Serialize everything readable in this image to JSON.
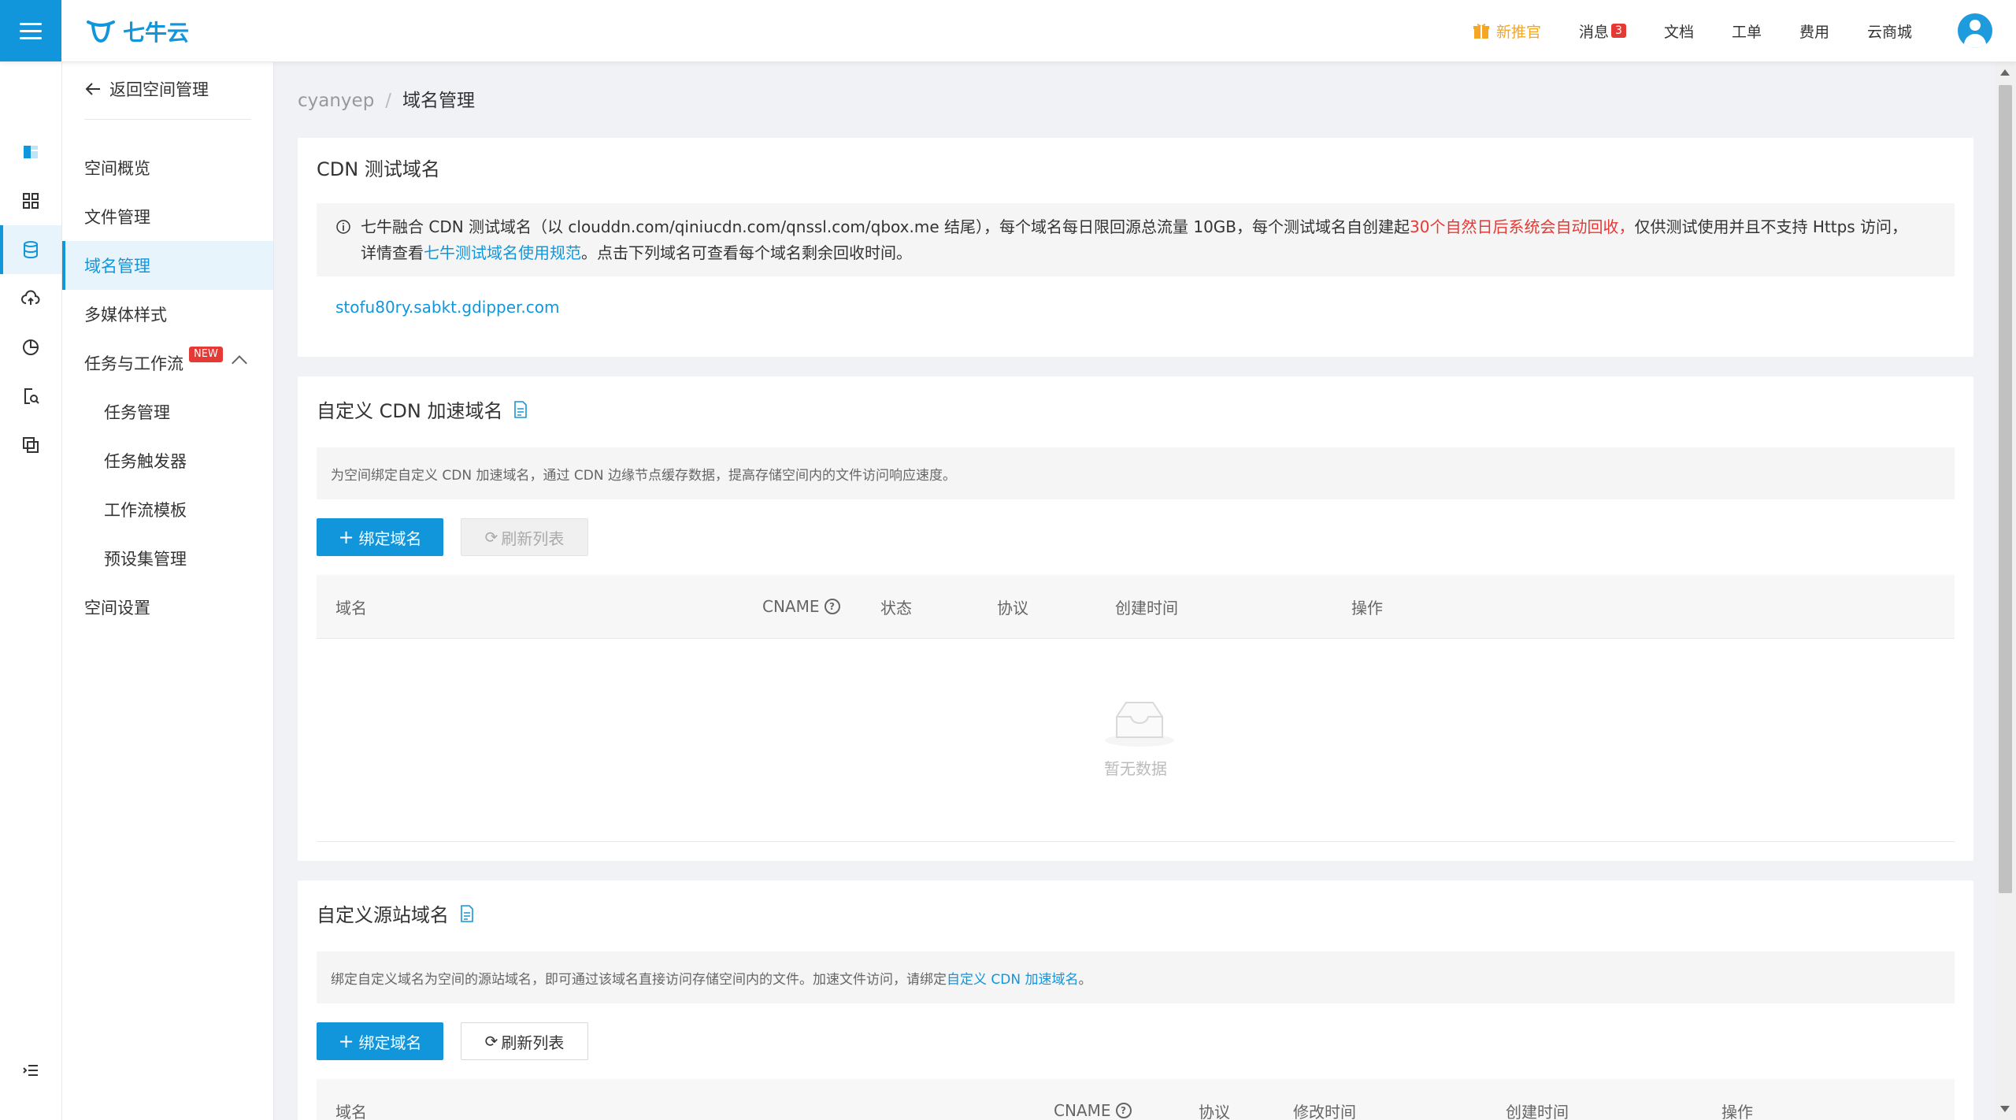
{
  "header": {
    "logo_text": "七牛云",
    "nav": [
      "新推官",
      "消息",
      "文档",
      "工单",
      "费用",
      "云商城"
    ],
    "message_count": "3",
    "accent_color": "#1296db"
  },
  "rail": {
    "icons": [
      "storage-icon",
      "grid-icon",
      "database-icon",
      "cloud-upload-icon",
      "pie-chart-icon",
      "file-search-icon",
      "copy-icon",
      "list-collapse-icon"
    ],
    "active_index": 2
  },
  "submenu": {
    "back_label": "返回空间管理",
    "items": [
      "空间概览",
      "文件管理",
      "域名管理",
      "多媒体样式",
      "任务与工作流"
    ],
    "new_badge": "NEW",
    "subitems": [
      "任务管理",
      "任务触发器",
      "工作流模板",
      "预设集管理"
    ],
    "settings": "空间设置",
    "active": "域名管理"
  },
  "breadcrumb": {
    "root": "cyanyep",
    "sep": "/",
    "current": "域名管理"
  },
  "test_domain": {
    "title": "CDN 测试域名",
    "info_part1": "七牛融合 CDN 测试域名（以 clouddn.com/qiniucdn.com/qnssl.com/qbox.me 结尾），每个域名每日限回源总流量 10GB，每个测试域名自创建起",
    "info_red": "30个自然日后系统会自动回收，",
    "info_part2": "仅供测试使用并且不支持 Https 访问，",
    "info_part3": "详情查看",
    "info_link": "七牛测试域名使用规范",
    "info_part4": "。点击下列域名可查看每个域名剩余回收时间。",
    "domain": "stofu80ry.sabkt.gdipper.com"
  },
  "cdn_domain": {
    "title": "自定义 CDN 加速域名",
    "desc": "为空间绑定自定义 CDN 加速域名，通过 CDN 边缘节点缓存数据，提高存储空间内的文件访问响应速度。",
    "bind_button": "绑定域名",
    "refresh_button": "刷新列表",
    "columns": [
      "域名",
      "CNAME",
      "状态",
      "协议",
      "创建时间",
      "操作"
    ],
    "empty_text": "暂无数据"
  },
  "source_domain": {
    "title": "自定义源站域名",
    "desc_part1": "绑定自定义域名为空间的源站域名，即可通过该域名直接访问存储空间内的文件。加速文件访问，请绑定",
    "desc_link": "自定义 CDN 加速域名",
    "desc_part2": "。",
    "bind_button": "绑定域名",
    "refresh_button": "刷新列表",
    "columns": [
      "域名",
      "CNAME",
      "协议",
      "修改时间",
      "创建时间",
      "操作"
    ]
  }
}
